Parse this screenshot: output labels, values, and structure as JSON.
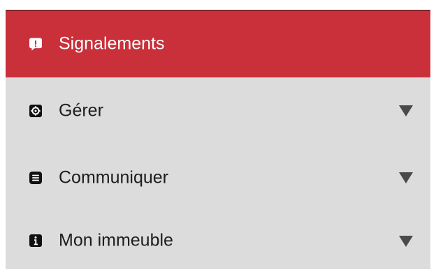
{
  "menu": {
    "items": [
      {
        "label": "Signalements",
        "icon": "alert-chat-icon",
        "active": true
      },
      {
        "label": "Gérer",
        "icon": "gear-icon",
        "expandable": true
      },
      {
        "label": "Communiquer",
        "icon": "message-icon",
        "expandable": true
      },
      {
        "label": "Mon immeuble",
        "icon": "info-icon",
        "expandable": true
      }
    ]
  },
  "colors": {
    "active_background": "#c9303a",
    "item_background": "#dcdcdc",
    "text_dark": "#1d1d1d",
    "text_light": "#ffffff"
  }
}
